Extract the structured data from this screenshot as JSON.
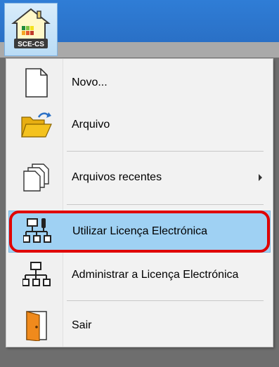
{
  "app": {
    "logo_text": "SCE-CS"
  },
  "menu": {
    "items": [
      {
        "label": "Novo...",
        "icon": "new-document-icon"
      },
      {
        "label": "Arquivo",
        "icon": "open-folder-icon"
      },
      {
        "label": "Arquivos recentes",
        "icon": "recent-files-icon",
        "has_submenu": true
      },
      {
        "label": "Utilizar Licença Electrónica",
        "icon": "network-license-icon",
        "selected": true
      },
      {
        "label": "Administrar a Licença Electrónica",
        "icon": "network-admin-icon"
      },
      {
        "label": "Sair",
        "icon": "exit-door-icon"
      }
    ]
  },
  "colors": {
    "titlebar": "#2f7dd6",
    "selected_bg": "#9fd1f3",
    "highlight_ring": "#e00000",
    "folder": "#f4c21e",
    "door": "#f08a1c"
  }
}
